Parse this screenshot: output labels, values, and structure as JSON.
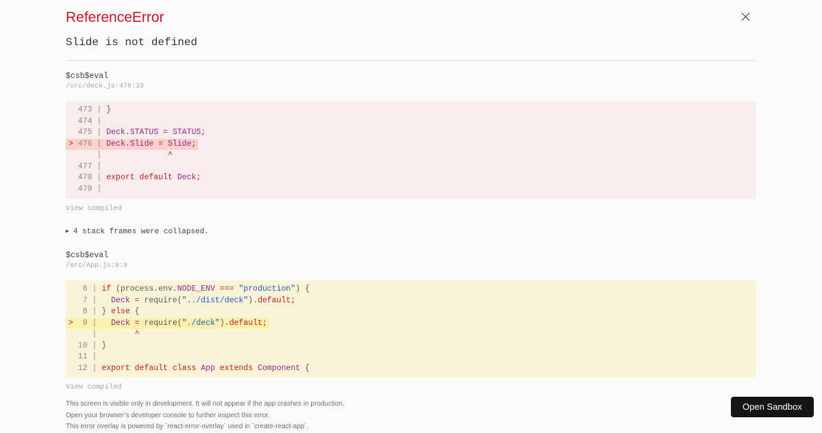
{
  "palette": {
    "g": "#8c8c8c",
    "d": "#575757",
    "k": "#c41a16",
    "v": "#93278f",
    "s": "#2a56c6",
    "m": "#c41a16"
  },
  "error": {
    "type": "ReferenceError",
    "message": "Slide is not defined"
  },
  "frames": [
    {
      "function_name": "$csb$eval",
      "location": "/src/deck.js:476:13",
      "view_compiled_label": "View compiled",
      "block_bg": "#f9ecec",
      "highlight_bg": "#fcd0cb",
      "lines": [
        {
          "hl": false,
          "segs": [
            {
              "t": "  473 | ",
              "c": "g"
            },
            {
              "t": "}",
              "c": "d"
            }
          ]
        },
        {
          "hl": false,
          "segs": [
            {
              "t": "  474 |",
              "c": "g"
            }
          ]
        },
        {
          "hl": false,
          "segs": [
            {
              "t": "  475 | ",
              "c": "g"
            },
            {
              "t": "Deck.STATUS",
              "c": "v"
            },
            {
              "t": " ",
              "c": "d"
            },
            {
              "t": "=",
              "c": "k"
            },
            {
              "t": " ",
              "c": "d"
            },
            {
              "t": "STATUS",
              "c": "v"
            },
            {
              "t": ";",
              "c": "k"
            }
          ]
        },
        {
          "hl": true,
          "segs": [
            {
              "t": "> ",
              "c": "m"
            },
            {
              "t": "476 | ",
              "c": "g"
            },
            {
              "t": "Deck.Slide",
              "c": "v"
            },
            {
              "t": " ",
              "c": "d"
            },
            {
              "t": "=",
              "c": "k"
            },
            {
              "t": " ",
              "c": "d"
            },
            {
              "t": "Slide",
              "c": "v"
            },
            {
              "t": ";",
              "c": "k"
            }
          ]
        },
        {
          "hl": false,
          "segs": [
            {
              "t": "      |",
              "c": "g"
            },
            {
              "t": "              ",
              "c": "d"
            },
            {
              "t": "^",
              "c": "k"
            }
          ]
        },
        {
          "hl": false,
          "segs": [
            {
              "t": "  477 |",
              "c": "g"
            }
          ]
        },
        {
          "hl": false,
          "segs": [
            {
              "t": "  478 | ",
              "c": "g"
            },
            {
              "t": "export",
              "c": "k"
            },
            {
              "t": " ",
              "c": "d"
            },
            {
              "t": "default",
              "c": "k"
            },
            {
              "t": " ",
              "c": "d"
            },
            {
              "t": "Deck",
              "c": "v"
            },
            {
              "t": ";",
              "c": "k"
            }
          ]
        },
        {
          "hl": false,
          "segs": [
            {
              "t": "  479 |",
              "c": "g"
            }
          ]
        }
      ]
    },
    {
      "function_name": "$csb$eval",
      "location": "/src/App.js:9:9",
      "view_compiled_label": "View compiled",
      "block_bg": "#f9f4d8",
      "highlight_bg": "#faf1ad",
      "lines": [
        {
          "hl": false,
          "segs": [
            {
              "t": "   6 | ",
              "c": "g"
            },
            {
              "t": "if",
              "c": "k"
            },
            {
              "t": " (process.env.",
              "c": "d"
            },
            {
              "t": "NODE_ENV",
              "c": "v"
            },
            {
              "t": " ",
              "c": "d"
            },
            {
              "t": "===",
              "c": "k"
            },
            {
              "t": " ",
              "c": "d"
            },
            {
              "t": "\"production\"",
              "c": "s"
            },
            {
              "t": ") {",
              "c": "d"
            }
          ]
        },
        {
          "hl": false,
          "segs": [
            {
              "t": "   7 | ",
              "c": "g"
            },
            {
              "t": "  ",
              "c": "d"
            },
            {
              "t": "Deck",
              "c": "v"
            },
            {
              "t": " ",
              "c": "d"
            },
            {
              "t": "=",
              "c": "k"
            },
            {
              "t": " require(",
              "c": "d"
            },
            {
              "t": "\"../dist/deck\"",
              "c": "s"
            },
            {
              "t": ").",
              "c": "d"
            },
            {
              "t": "default;",
              "c": "k"
            }
          ]
        },
        {
          "hl": false,
          "segs": [
            {
              "t": "   8 | ",
              "c": "g"
            },
            {
              "t": "} ",
              "c": "d"
            },
            {
              "t": "else",
              "c": "k"
            },
            {
              "t": " {",
              "c": "d"
            }
          ]
        },
        {
          "hl": true,
          "segs": [
            {
              "t": "> ",
              "c": "m"
            },
            {
              "t": " 9 | ",
              "c": "g"
            },
            {
              "t": "  ",
              "c": "d"
            },
            {
              "t": "Deck",
              "c": "v"
            },
            {
              "t": " ",
              "c": "d"
            },
            {
              "t": "=",
              "c": "k"
            },
            {
              "t": " require(",
              "c": "d"
            },
            {
              "t": "\"./deck\"",
              "c": "s"
            },
            {
              "t": ").",
              "c": "d"
            },
            {
              "t": "default;",
              "c": "k"
            }
          ]
        },
        {
          "hl": false,
          "segs": [
            {
              "t": "     |",
              "c": "g"
            },
            {
              "t": "        ",
              "c": "d"
            },
            {
              "t": "^",
              "c": "k"
            }
          ]
        },
        {
          "hl": false,
          "segs": [
            {
              "t": "  10 | ",
              "c": "g"
            },
            {
              "t": "}",
              "c": "d"
            }
          ]
        },
        {
          "hl": false,
          "segs": [
            {
              "t": "  11 |",
              "c": "g"
            }
          ]
        },
        {
          "hl": false,
          "segs": [
            {
              "t": "  12 | ",
              "c": "g"
            },
            {
              "t": "export",
              "c": "k"
            },
            {
              "t": " ",
              "c": "d"
            },
            {
              "t": "default",
              "c": "k"
            },
            {
              "t": " ",
              "c": "d"
            },
            {
              "t": "class",
              "c": "k"
            },
            {
              "t": " ",
              "c": "d"
            },
            {
              "t": "App",
              "c": "v"
            },
            {
              "t": " ",
              "c": "d"
            },
            {
              "t": "extends",
              "c": "k"
            },
            {
              "t": " ",
              "c": "d"
            },
            {
              "t": "Component",
              "c": "v"
            },
            {
              "t": " {",
              "c": "d"
            }
          ]
        }
      ]
    }
  ],
  "collapsed": {
    "icon": "▶",
    "label": "4 stack frames were collapsed."
  },
  "footer": {
    "line1": "This screen is visible only in development. It will not appear if the app crashes in production.",
    "line2": "Open your browser’s developer console to further inspect this error.",
    "line3": "This error overlay is powered by `react-error-overlay` used in `create-react-app`."
  },
  "sandbox": {
    "label": "Open Sandbox",
    "bg": "#151515"
  }
}
